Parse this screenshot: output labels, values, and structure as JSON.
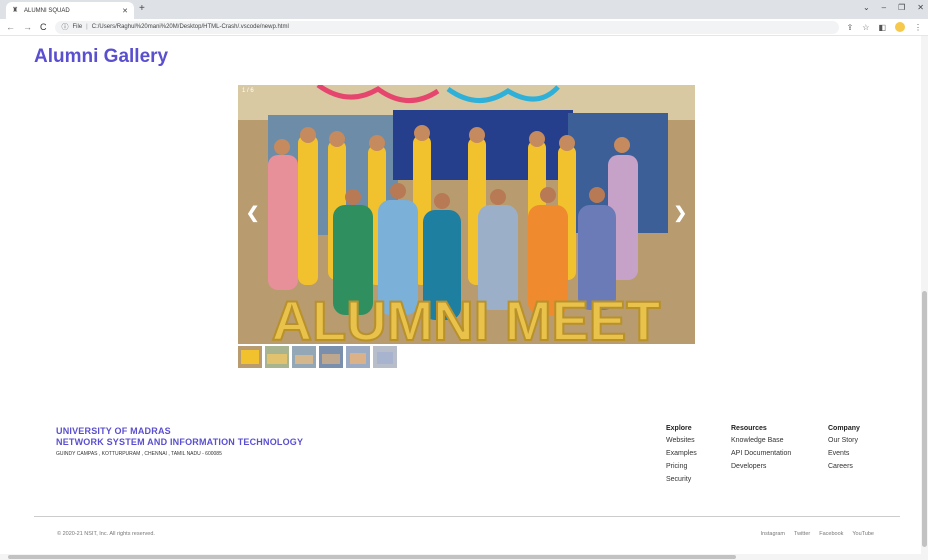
{
  "browser": {
    "tab_title": "ALUMNI SQUAD",
    "address_prefix": "File",
    "url": "C:/Users/Raghul%20mani%20M/Desktop/HTML-Crash/.vscode/newp.html"
  },
  "gallery": {
    "title": "Alumni Gallery",
    "counter": "1 / 6",
    "banner_text": "ALUMNI MEET",
    "thumbnail_count": 6
  },
  "footer": {
    "org_line1": "UNIVERSITY OF MADRAS",
    "org_line2": "NETWORK SYSTEM AND INFORMATION TECHNOLOGY",
    "address": "GUINDY CAMPAS , KOTTURPURAM , CHENNAI , TAMIL NADU - 600085",
    "explore": {
      "heading": "Explore",
      "links": [
        "Websites",
        "Examples",
        "Pricing",
        "Security"
      ]
    },
    "resources": {
      "heading": "Resources",
      "links": [
        "Knowledge Base",
        "API Documentation",
        "Developers"
      ]
    },
    "company": {
      "heading": "Company",
      "links": [
        "Our Story",
        "Events",
        "Careers"
      ]
    },
    "copyright": "© 2020-21 NSIT, Inc. All rights reserved.",
    "socials": [
      "Instagram",
      "Twitter",
      "Facebook",
      "YouTube"
    ]
  },
  "colors": {
    "brand": "#5a4fcf"
  }
}
